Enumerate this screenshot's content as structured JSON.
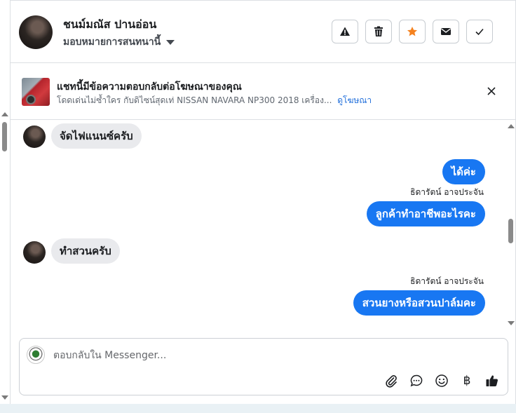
{
  "header": {
    "name": "ชนม์มณัส ปานอ่อน",
    "assign_label": "มอบหมายการสนทนานี้",
    "actions": [
      {
        "icon": "warning-icon"
      },
      {
        "icon": "trash-icon"
      },
      {
        "icon": "star-icon",
        "color": "#f5821f"
      },
      {
        "icon": "mail-icon"
      },
      {
        "icon": "check-icon"
      }
    ]
  },
  "ad_banner": {
    "title": "แชทนี้มีข้อความตอบกลับต่อโฆษณาของคุณ",
    "subtitle": "โดดเด่นไม่ซ้ำใคร กับดิไซน์สุดเท่ NISSAN NAVARA NP300 2018 เครื่อง...",
    "link": "ดูโฆษณา"
  },
  "messages": [
    {
      "direction": "in",
      "text": "จัดไฟแนนซ์ครับ"
    },
    {
      "direction": "out",
      "text": "ได้ค่ะ"
    },
    {
      "direction": "out",
      "sender": "ธิดารัตน์ อาจประจัน",
      "text": "ลูกค้าทำอาชีพอะไรคะ"
    },
    {
      "direction": "in",
      "text": "ทำสวนครับ"
    },
    {
      "direction": "out",
      "sender": "ธิดารัตน์ อาจประจัน",
      "text": "สวนยางหรือสวนปาล์มคะ"
    }
  ],
  "composer": {
    "placeholder": "ตอบกลับใน Messenger...",
    "value": "",
    "tools": [
      "paperclip-icon",
      "speech-bubble-icon",
      "smiley-icon",
      "baht-icon",
      "thumbs-up-icon"
    ],
    "baht_symbol": "฿"
  },
  "colors": {
    "accent": "#1877f2",
    "incoming_bubble": "#e9eaed",
    "star": "#f5821f",
    "link": "#216fdb"
  }
}
